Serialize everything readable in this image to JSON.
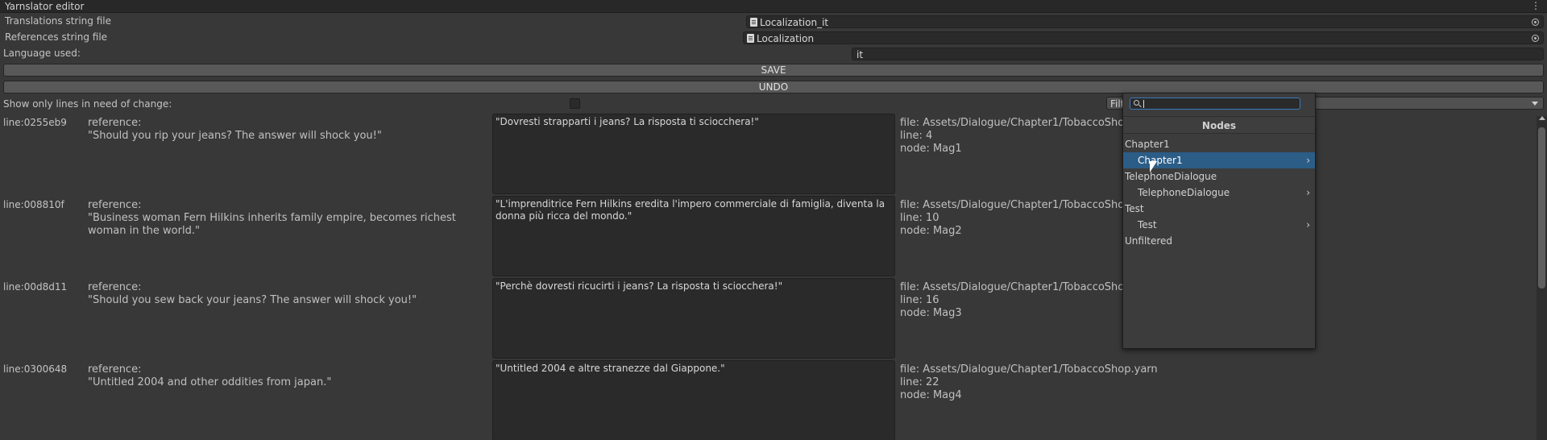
{
  "window": {
    "title": "Yarnslator editor",
    "menu_icon": "vertical-dots-icon"
  },
  "fields": {
    "translations_label": "Translations string file",
    "translations_value": "Localization_it",
    "references_label": "References string file",
    "references_value": "Localization",
    "language_label": "Language used:",
    "language_value": "it"
  },
  "buttons": {
    "save": "SAVE",
    "undo": "UNDO"
  },
  "filter": {
    "show_only_label": "Show only lines in need of change:",
    "show_only_checked": false,
    "dropdown_value": "Filt"
  },
  "lines": [
    {
      "id": "line:0255eb9",
      "reference_label": "reference:",
      "reference": "\"Should you rip your jeans? The answer will shock you!\"",
      "translation": "\"Dovresti strapparti i jeans? La risposta ti sciocchera!\"",
      "file": "file: Assets/Dialogue/Chapter1/TobaccoShop",
      "line": "line: 4",
      "node": "node: Mag1"
    },
    {
      "id": "line:008810f",
      "reference_label": "reference:",
      "reference": "\"Business woman Fern Hilkins inherits family empire, becomes richest woman in the world.\"",
      "translation": "\"L'imprenditrice Fern Hilkins eredita l'impero commerciale di famiglia, diventa la donna più ricca del mondo.\"",
      "file": "file: Assets/Dialogue/Chapter1/TobaccoShop",
      "line": "line: 10",
      "node": "node: Mag2"
    },
    {
      "id": "line:00d8d11",
      "reference_label": "reference:",
      "reference": "\"Should you sew back your jeans? The answer will shock you!\"",
      "translation": "\"Perchè dovresti ricucirti i jeans? La risposta ti sciocchera!\"",
      "file": "file: Assets/Dialogue/Chapter1/TobaccoShop",
      "line": "line: 16",
      "node": "node: Mag3"
    },
    {
      "id": "line:0300648",
      "reference_label": "reference:",
      "reference": "\"Untitled 2004 and other oddities from japan.\"",
      "translation": "\"Untitled 2004 e altre stranezze dal Giappone.\"",
      "file": "file: Assets/Dialogue/Chapter1/TobaccoShop.yarn",
      "line": "line: 22",
      "node": "node: Mag4"
    }
  ],
  "popup": {
    "search_value": "",
    "header": "Nodes",
    "items": [
      {
        "label": "Chapter1",
        "selected": false,
        "submenu": false
      },
      {
        "label": "Chapter1",
        "selected": true,
        "submenu": true
      },
      {
        "label": "TelephoneDialogue",
        "selected": false,
        "submenu": false
      },
      {
        "label": "TelephoneDialogue",
        "selected": false,
        "submenu": true
      },
      {
        "label": "Test",
        "selected": false,
        "submenu": false
      },
      {
        "label": "Test",
        "selected": false,
        "submenu": true
      },
      {
        "label": "Unfiltered",
        "selected": false,
        "submenu": false
      }
    ]
  }
}
